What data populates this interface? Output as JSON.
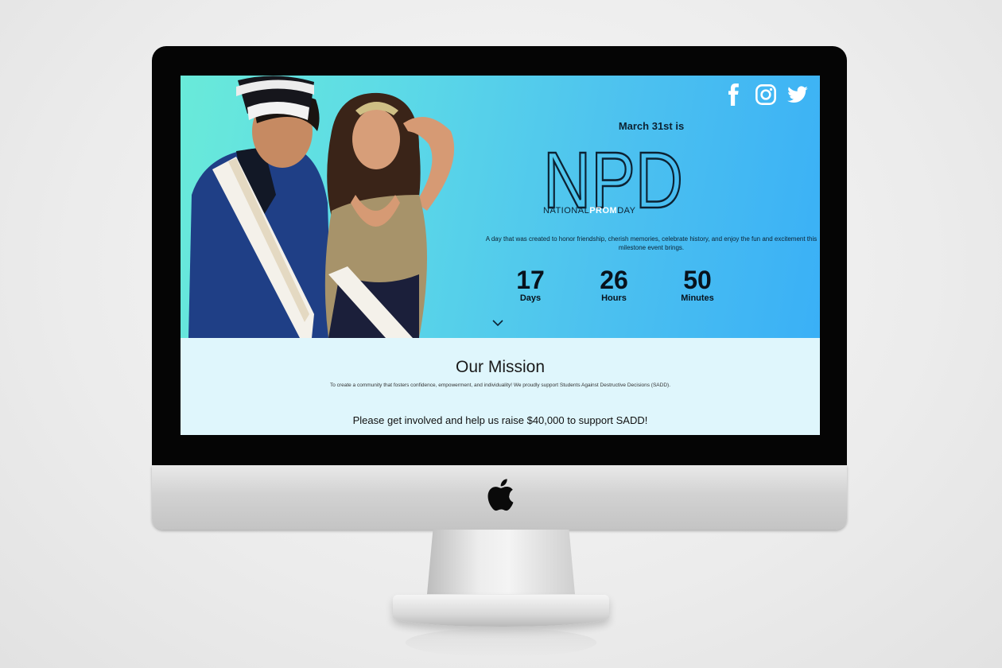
{
  "social": {
    "facebook": "facebook-icon",
    "instagram": "instagram-icon",
    "twitter": "twitter-icon"
  },
  "hero": {
    "tagline": "March 31st is",
    "logo_text": "NPD",
    "logo_sub_1": "NATIONAL",
    "logo_sub_highlight": "PROM",
    "logo_sub_2": "DAY",
    "description": "A day that was created to honor friendship, cherish memories, celebrate history, and enjoy the fun and excitement this milestone event brings.",
    "countdown": [
      {
        "value": "17",
        "label": "Days"
      },
      {
        "value": "26",
        "label": "Hours"
      },
      {
        "value": "50",
        "label": "Minutes"
      }
    ],
    "scroll_icon": "chevron-down-icon"
  },
  "mission": {
    "title": "Our Mission",
    "text": "To create a community that fosters confidence, empowerment, and individuality! We proudly support Students Against Destructive Decisions (SADD).",
    "cta": "Please get involved and help us raise $40,000 to support SADD!"
  },
  "device": {
    "logo": "apple-logo"
  },
  "colors": {
    "hero_start": "#69ead9",
    "hero_end": "#3ab0f6",
    "mission_bg": "#dff6fc",
    "text_dark": "#0c2233"
  }
}
